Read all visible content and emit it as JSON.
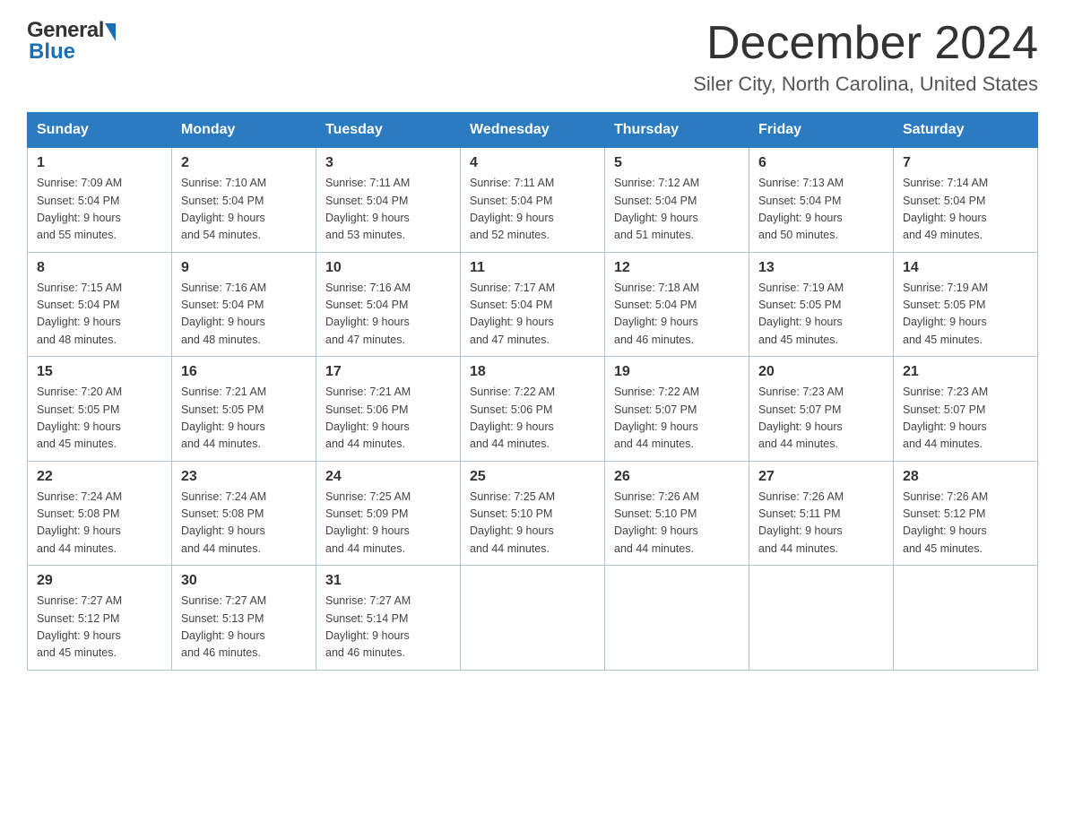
{
  "logo": {
    "general": "General",
    "blue": "Blue"
  },
  "title": {
    "month": "December 2024",
    "location": "Siler City, North Carolina, United States"
  },
  "weekdays": [
    "Sunday",
    "Monday",
    "Tuesday",
    "Wednesday",
    "Thursday",
    "Friday",
    "Saturday"
  ],
  "weeks": [
    [
      {
        "day": "1",
        "sunrise": "7:09 AM",
        "sunset": "5:04 PM",
        "daylight": "9 hours and 55 minutes."
      },
      {
        "day": "2",
        "sunrise": "7:10 AM",
        "sunset": "5:04 PM",
        "daylight": "9 hours and 54 minutes."
      },
      {
        "day": "3",
        "sunrise": "7:11 AM",
        "sunset": "5:04 PM",
        "daylight": "9 hours and 53 minutes."
      },
      {
        "day": "4",
        "sunrise": "7:11 AM",
        "sunset": "5:04 PM",
        "daylight": "9 hours and 52 minutes."
      },
      {
        "day": "5",
        "sunrise": "7:12 AM",
        "sunset": "5:04 PM",
        "daylight": "9 hours and 51 minutes."
      },
      {
        "day": "6",
        "sunrise": "7:13 AM",
        "sunset": "5:04 PM",
        "daylight": "9 hours and 50 minutes."
      },
      {
        "day": "7",
        "sunrise": "7:14 AM",
        "sunset": "5:04 PM",
        "daylight": "9 hours and 49 minutes."
      }
    ],
    [
      {
        "day": "8",
        "sunrise": "7:15 AM",
        "sunset": "5:04 PM",
        "daylight": "9 hours and 48 minutes."
      },
      {
        "day": "9",
        "sunrise": "7:16 AM",
        "sunset": "5:04 PM",
        "daylight": "9 hours and 48 minutes."
      },
      {
        "day": "10",
        "sunrise": "7:16 AM",
        "sunset": "5:04 PM",
        "daylight": "9 hours and 47 minutes."
      },
      {
        "day": "11",
        "sunrise": "7:17 AM",
        "sunset": "5:04 PM",
        "daylight": "9 hours and 47 minutes."
      },
      {
        "day": "12",
        "sunrise": "7:18 AM",
        "sunset": "5:04 PM",
        "daylight": "9 hours and 46 minutes."
      },
      {
        "day": "13",
        "sunrise": "7:19 AM",
        "sunset": "5:05 PM",
        "daylight": "9 hours and 45 minutes."
      },
      {
        "day": "14",
        "sunrise": "7:19 AM",
        "sunset": "5:05 PM",
        "daylight": "9 hours and 45 minutes."
      }
    ],
    [
      {
        "day": "15",
        "sunrise": "7:20 AM",
        "sunset": "5:05 PM",
        "daylight": "9 hours and 45 minutes."
      },
      {
        "day": "16",
        "sunrise": "7:21 AM",
        "sunset": "5:05 PM",
        "daylight": "9 hours and 44 minutes."
      },
      {
        "day": "17",
        "sunrise": "7:21 AM",
        "sunset": "5:06 PM",
        "daylight": "9 hours and 44 minutes."
      },
      {
        "day": "18",
        "sunrise": "7:22 AM",
        "sunset": "5:06 PM",
        "daylight": "9 hours and 44 minutes."
      },
      {
        "day": "19",
        "sunrise": "7:22 AM",
        "sunset": "5:07 PM",
        "daylight": "9 hours and 44 minutes."
      },
      {
        "day": "20",
        "sunrise": "7:23 AM",
        "sunset": "5:07 PM",
        "daylight": "9 hours and 44 minutes."
      },
      {
        "day": "21",
        "sunrise": "7:23 AM",
        "sunset": "5:07 PM",
        "daylight": "9 hours and 44 minutes."
      }
    ],
    [
      {
        "day": "22",
        "sunrise": "7:24 AM",
        "sunset": "5:08 PM",
        "daylight": "9 hours and 44 minutes."
      },
      {
        "day": "23",
        "sunrise": "7:24 AM",
        "sunset": "5:08 PM",
        "daylight": "9 hours and 44 minutes."
      },
      {
        "day": "24",
        "sunrise": "7:25 AM",
        "sunset": "5:09 PM",
        "daylight": "9 hours and 44 minutes."
      },
      {
        "day": "25",
        "sunrise": "7:25 AM",
        "sunset": "5:10 PM",
        "daylight": "9 hours and 44 minutes."
      },
      {
        "day": "26",
        "sunrise": "7:26 AM",
        "sunset": "5:10 PM",
        "daylight": "9 hours and 44 minutes."
      },
      {
        "day": "27",
        "sunrise": "7:26 AM",
        "sunset": "5:11 PM",
        "daylight": "9 hours and 44 minutes."
      },
      {
        "day": "28",
        "sunrise": "7:26 AM",
        "sunset": "5:12 PM",
        "daylight": "9 hours and 45 minutes."
      }
    ],
    [
      {
        "day": "29",
        "sunrise": "7:27 AM",
        "sunset": "5:12 PM",
        "daylight": "9 hours and 45 minutes."
      },
      {
        "day": "30",
        "sunrise": "7:27 AM",
        "sunset": "5:13 PM",
        "daylight": "9 hours and 46 minutes."
      },
      {
        "day": "31",
        "sunrise": "7:27 AM",
        "sunset": "5:14 PM",
        "daylight": "9 hours and 46 minutes."
      },
      null,
      null,
      null,
      null
    ]
  ],
  "labels": {
    "sunrise": "Sunrise: ",
    "sunset": "Sunset: ",
    "daylight": "Daylight: "
  }
}
